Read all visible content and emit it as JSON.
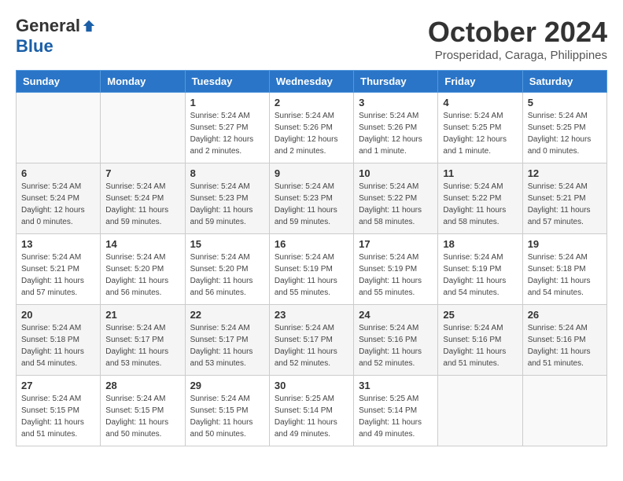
{
  "header": {
    "logo_general": "General",
    "logo_blue": "Blue",
    "month_title": "October 2024",
    "location": "Prosperidad, Caraga, Philippines"
  },
  "days_of_week": [
    "Sunday",
    "Monday",
    "Tuesday",
    "Wednesday",
    "Thursday",
    "Friday",
    "Saturday"
  ],
  "weeks": [
    [
      {
        "day": "",
        "info": ""
      },
      {
        "day": "",
        "info": ""
      },
      {
        "day": "1",
        "info": "Sunrise: 5:24 AM\nSunset: 5:27 PM\nDaylight: 12 hours\nand 2 minutes."
      },
      {
        "day": "2",
        "info": "Sunrise: 5:24 AM\nSunset: 5:26 PM\nDaylight: 12 hours\nand 2 minutes."
      },
      {
        "day": "3",
        "info": "Sunrise: 5:24 AM\nSunset: 5:26 PM\nDaylight: 12 hours\nand 1 minute."
      },
      {
        "day": "4",
        "info": "Sunrise: 5:24 AM\nSunset: 5:25 PM\nDaylight: 12 hours\nand 1 minute."
      },
      {
        "day": "5",
        "info": "Sunrise: 5:24 AM\nSunset: 5:25 PM\nDaylight: 12 hours\nand 0 minutes."
      }
    ],
    [
      {
        "day": "6",
        "info": "Sunrise: 5:24 AM\nSunset: 5:24 PM\nDaylight: 12 hours\nand 0 minutes."
      },
      {
        "day": "7",
        "info": "Sunrise: 5:24 AM\nSunset: 5:24 PM\nDaylight: 11 hours\nand 59 minutes."
      },
      {
        "day": "8",
        "info": "Sunrise: 5:24 AM\nSunset: 5:23 PM\nDaylight: 11 hours\nand 59 minutes."
      },
      {
        "day": "9",
        "info": "Sunrise: 5:24 AM\nSunset: 5:23 PM\nDaylight: 11 hours\nand 59 minutes."
      },
      {
        "day": "10",
        "info": "Sunrise: 5:24 AM\nSunset: 5:22 PM\nDaylight: 11 hours\nand 58 minutes."
      },
      {
        "day": "11",
        "info": "Sunrise: 5:24 AM\nSunset: 5:22 PM\nDaylight: 11 hours\nand 58 minutes."
      },
      {
        "day": "12",
        "info": "Sunrise: 5:24 AM\nSunset: 5:21 PM\nDaylight: 11 hours\nand 57 minutes."
      }
    ],
    [
      {
        "day": "13",
        "info": "Sunrise: 5:24 AM\nSunset: 5:21 PM\nDaylight: 11 hours\nand 57 minutes."
      },
      {
        "day": "14",
        "info": "Sunrise: 5:24 AM\nSunset: 5:20 PM\nDaylight: 11 hours\nand 56 minutes."
      },
      {
        "day": "15",
        "info": "Sunrise: 5:24 AM\nSunset: 5:20 PM\nDaylight: 11 hours\nand 56 minutes."
      },
      {
        "day": "16",
        "info": "Sunrise: 5:24 AM\nSunset: 5:19 PM\nDaylight: 11 hours\nand 55 minutes."
      },
      {
        "day": "17",
        "info": "Sunrise: 5:24 AM\nSunset: 5:19 PM\nDaylight: 11 hours\nand 55 minutes."
      },
      {
        "day": "18",
        "info": "Sunrise: 5:24 AM\nSunset: 5:19 PM\nDaylight: 11 hours\nand 54 minutes."
      },
      {
        "day": "19",
        "info": "Sunrise: 5:24 AM\nSunset: 5:18 PM\nDaylight: 11 hours\nand 54 minutes."
      }
    ],
    [
      {
        "day": "20",
        "info": "Sunrise: 5:24 AM\nSunset: 5:18 PM\nDaylight: 11 hours\nand 54 minutes."
      },
      {
        "day": "21",
        "info": "Sunrise: 5:24 AM\nSunset: 5:17 PM\nDaylight: 11 hours\nand 53 minutes."
      },
      {
        "day": "22",
        "info": "Sunrise: 5:24 AM\nSunset: 5:17 PM\nDaylight: 11 hours\nand 53 minutes."
      },
      {
        "day": "23",
        "info": "Sunrise: 5:24 AM\nSunset: 5:17 PM\nDaylight: 11 hours\nand 52 minutes."
      },
      {
        "day": "24",
        "info": "Sunrise: 5:24 AM\nSunset: 5:16 PM\nDaylight: 11 hours\nand 52 minutes."
      },
      {
        "day": "25",
        "info": "Sunrise: 5:24 AM\nSunset: 5:16 PM\nDaylight: 11 hours\nand 51 minutes."
      },
      {
        "day": "26",
        "info": "Sunrise: 5:24 AM\nSunset: 5:16 PM\nDaylight: 11 hours\nand 51 minutes."
      }
    ],
    [
      {
        "day": "27",
        "info": "Sunrise: 5:24 AM\nSunset: 5:15 PM\nDaylight: 11 hours\nand 51 minutes."
      },
      {
        "day": "28",
        "info": "Sunrise: 5:24 AM\nSunset: 5:15 PM\nDaylight: 11 hours\nand 50 minutes."
      },
      {
        "day": "29",
        "info": "Sunrise: 5:24 AM\nSunset: 5:15 PM\nDaylight: 11 hours\nand 50 minutes."
      },
      {
        "day": "30",
        "info": "Sunrise: 5:25 AM\nSunset: 5:14 PM\nDaylight: 11 hours\nand 49 minutes."
      },
      {
        "day": "31",
        "info": "Sunrise: 5:25 AM\nSunset: 5:14 PM\nDaylight: 11 hours\nand 49 minutes."
      },
      {
        "day": "",
        "info": ""
      },
      {
        "day": "",
        "info": ""
      }
    ]
  ]
}
